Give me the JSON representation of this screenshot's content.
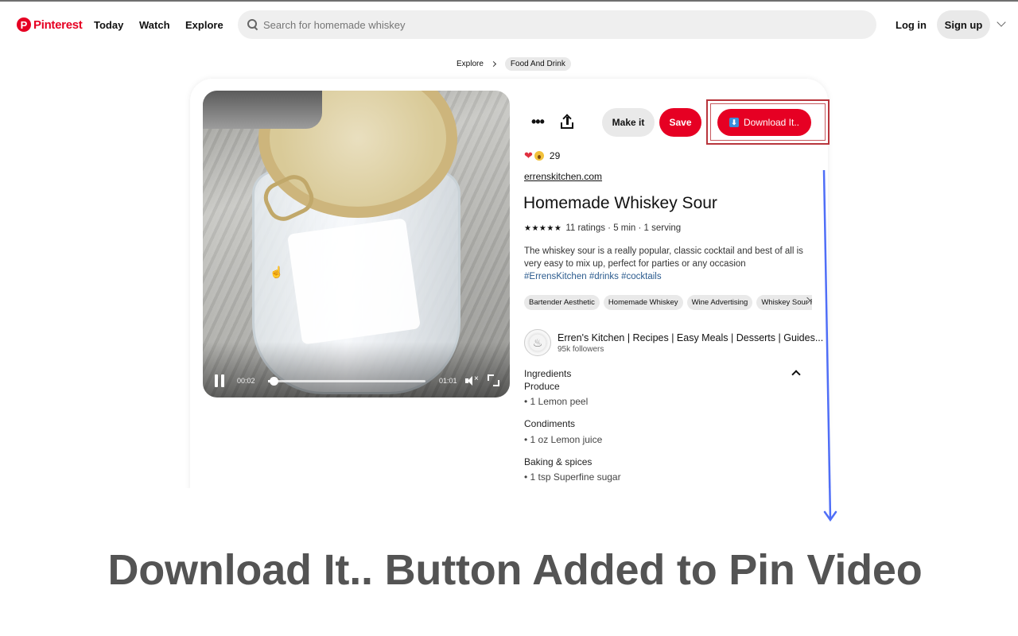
{
  "header": {
    "logo_text": "Pinterest",
    "logo_mark": "P",
    "nav": [
      "Today",
      "Watch",
      "Explore"
    ],
    "search_placeholder": "Search for homemade whiskey",
    "login_label": "Log in",
    "signup_label": "Sign up"
  },
  "breadcrumb": {
    "items": [
      "Explore",
      "Food And Drink"
    ]
  },
  "video": {
    "current_time": "00:02",
    "duration": "01:01",
    "progress_fraction": 0.033,
    "cursor_glyph": "☝",
    "mute_x": "×"
  },
  "actions": {
    "more_label": "•••",
    "make_it_label": "Make it",
    "save_label": "Save",
    "download_label": "Download It..",
    "download_icon_glyph": "⬇"
  },
  "colors": {
    "brand": "#e60023",
    "highlight": "#b8353c",
    "annotation_arrow": "#4f6ef7",
    "hashtag": "#2b5b8e"
  },
  "pin": {
    "reaction_count": "29",
    "heart_glyph": "❤",
    "source": "errenskitchen.com",
    "title": "Homemade Whiskey Sour",
    "stars": "★★★★★",
    "rating_meta": "11 ratings · 5 min · 1 serving",
    "description": "The whiskey sour is a really popular, classic cocktail and best of all is very easy to mix up, perfect for parties or any occasion",
    "hashtags": "#ErrensKitchen #drinks #cocktails",
    "tags": [
      "Bartender Aesthetic",
      "Homemade Whiskey",
      "Wine Advertising",
      "Whiskey Sour Recipe"
    ],
    "creator": {
      "name": "Erren's Kitchen | Recipes | Easy Meals | Desserts | Guides...",
      "followers": "95k followers",
      "avatar_glyph": "♨"
    },
    "ingredients": {
      "heading": "Ingredients",
      "sections": [
        {
          "name": "Produce",
          "items": [
            "• 1 Lemon peel"
          ]
        },
        {
          "name": "Condiments",
          "items": [
            "• 1 oz Lemon juice"
          ]
        },
        {
          "name": "Baking & spices",
          "items": [
            "• 1 tsp Superfine sugar"
          ]
        }
      ]
    }
  },
  "caption": "Download It.. Button Added to Pin Video"
}
